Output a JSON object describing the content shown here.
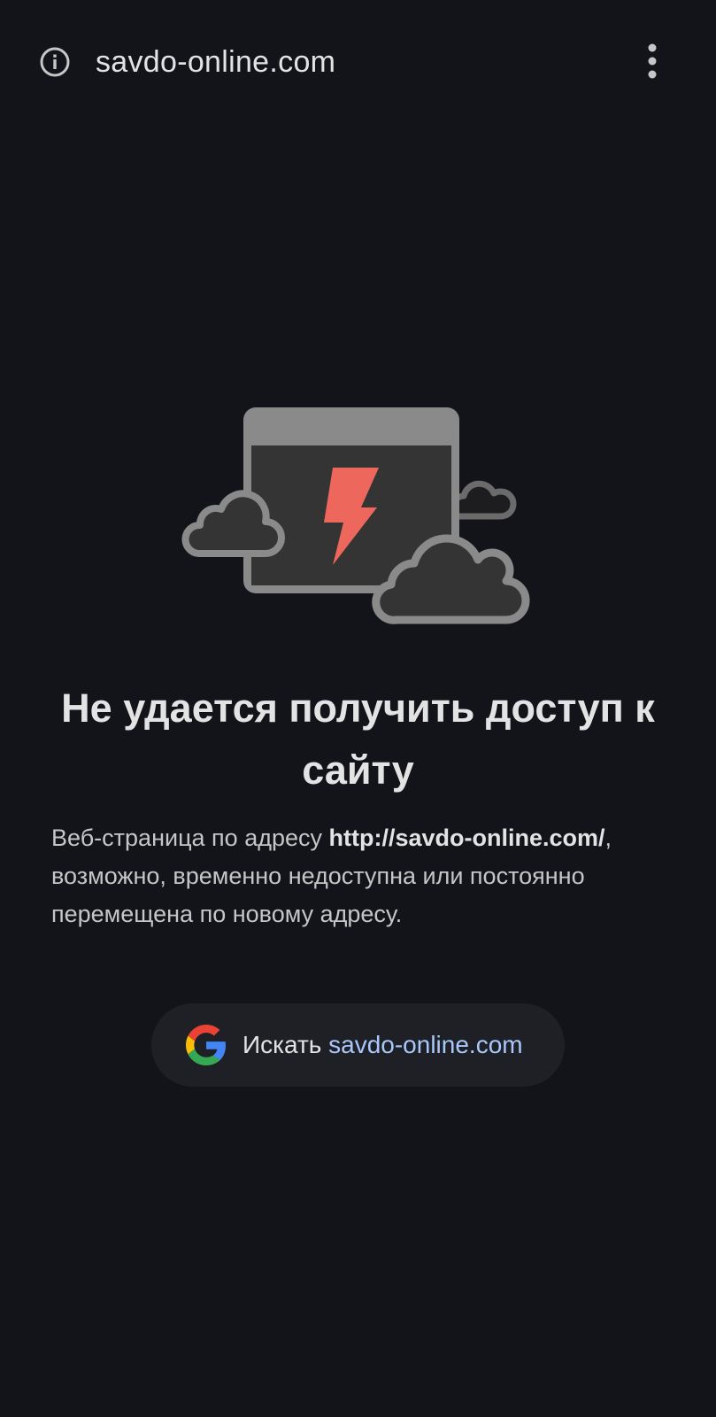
{
  "toolbar": {
    "url": "savdo-online.com",
    "info_icon": "info-icon",
    "menu_icon": "more-vert-icon"
  },
  "illustration": {
    "icon": "offline-browser-icon",
    "accent_color": "#ee675c"
  },
  "error": {
    "heading": "Не удается получить доступ к сайту",
    "description_prefix": "Веб-страница по адресу ",
    "description_url": "http://savdo-online.com/",
    "description_suffix": ", возможно, временно недоступна или постоянно перемещена по новому адресу."
  },
  "search_suggestion": {
    "icon": "google-g-icon",
    "label": "Искать ",
    "query": "savdo-online.com"
  },
  "colors": {
    "background": "#12141a",
    "pill_background": "#1e2026",
    "link": "#a8c7fa"
  }
}
